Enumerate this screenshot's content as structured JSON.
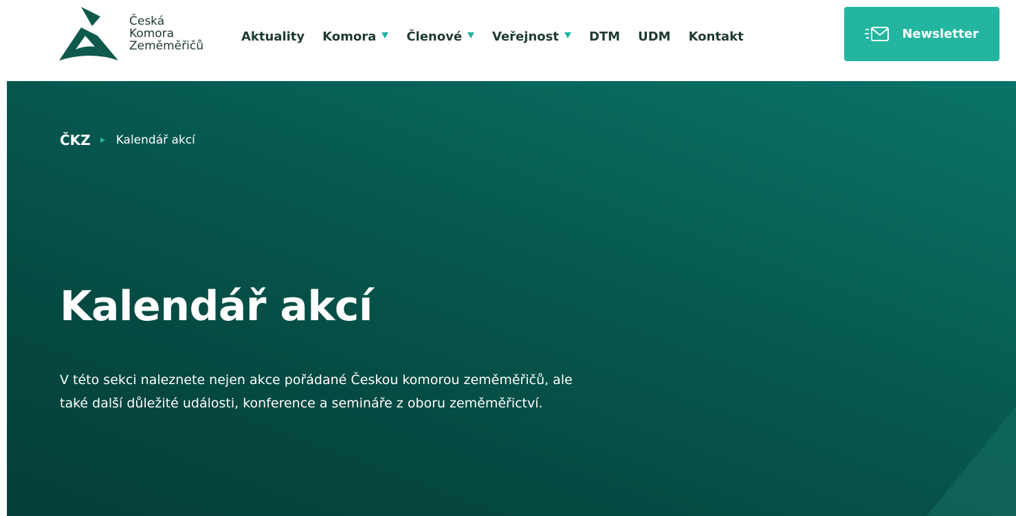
{
  "header": {
    "logo": {
      "line1": "Česká",
      "line2": "Komora",
      "line3": "Zeměměřičů",
      "icon": "ckz-logo-icon"
    },
    "nav": [
      {
        "label": "Aktuality",
        "dropdown": false
      },
      {
        "label": "Komora",
        "dropdown": true
      },
      {
        "label": "Členové",
        "dropdown": true
      },
      {
        "label": "Veřejnost",
        "dropdown": true
      },
      {
        "label": "DTM",
        "dropdown": false
      },
      {
        "label": "UDM",
        "dropdown": false
      },
      {
        "label": "Kontakt",
        "dropdown": false
      }
    ],
    "newsletter": {
      "label": "Newsletter",
      "icon": "mail-icon"
    }
  },
  "hero": {
    "breadcrumb": {
      "home": "ČKZ",
      "current": "Kalendář akcí"
    },
    "title": "Kalendář akcí",
    "description": "V této sekci naleznete nejen akce pořádané Českou komorou zeměměřičů, ale také další důležité události, konference a semináře z oboru zeměměřictví."
  },
  "colors": {
    "accent": "#24b5a0",
    "hero_dark": "#054a42",
    "text_dark": "#1f3a33"
  }
}
